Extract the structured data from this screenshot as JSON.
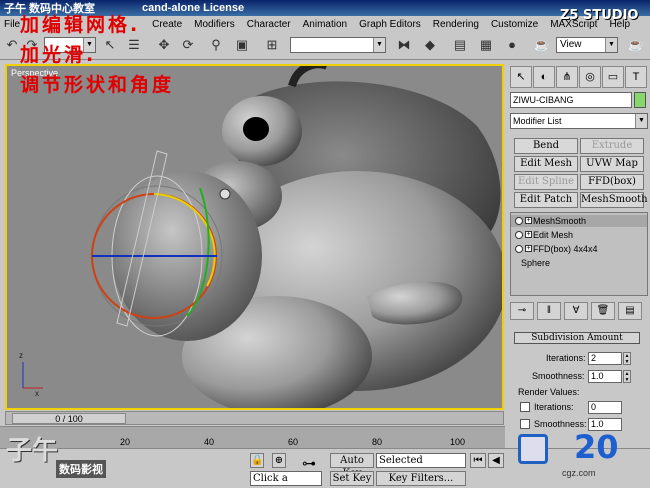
{
  "window": {
    "title": "cand-alone License",
    "watermark_corner": "子午 数码中心教室"
  },
  "menu": [
    "File",
    "Create",
    "Modifiers",
    "Character",
    "Animation",
    "Graph Editors",
    "Rendering",
    "Customize",
    "MAXScript",
    "Help"
  ],
  "toolbar": {
    "selection_combo": "",
    "view_combo": "View",
    "named_sets": ""
  },
  "studio_logo": "Z5 STUDIO",
  "overlay": {
    "line1": "加编辑网格.",
    "line2": "加光滑.",
    "line3": "调节形状和角度"
  },
  "viewport": {
    "label": "Perspective"
  },
  "command_panel": {
    "object_name": "ZIWU-CIBANG",
    "modifier_list": "Modifier List",
    "buttons": [
      {
        "label": "Bend",
        "enabled": true
      },
      {
        "label": "Extrude",
        "enabled": false
      },
      {
        "label": "Edit Mesh",
        "enabled": true
      },
      {
        "label": "UVW Map",
        "enabled": true
      },
      {
        "label": "Edit Spline",
        "enabled": false
      },
      {
        "label": "FFD(box)",
        "enabled": true
      },
      {
        "label": "Edit Patch",
        "enabled": true
      },
      {
        "label": "MeshSmooth",
        "enabled": true
      }
    ],
    "stack": [
      "MeshSmooth",
      "Edit Mesh",
      "FFD(box) 4x4x4",
      "Sphere"
    ],
    "rollout_title": "Subdivision Amount",
    "iterations_label": "Iterations:",
    "iterations_value": "2",
    "smoothness_label": "Smoothness:",
    "smoothness_value": "1.0",
    "render_values_label": "Render Values:",
    "r_iterations_label": "Iterations:",
    "r_iterations_value": "0",
    "r_smoothness_label": "Smoothness:",
    "r_smoothness_value": "1.0"
  },
  "timeline": {
    "frame_label": "0 / 100",
    "ticks": [
      "20",
      "40",
      "60",
      "80",
      "100"
    ]
  },
  "bottom": {
    "auto_key": "Auto Key",
    "set_key": "Set Key",
    "selected": "Selected",
    "key_filters": "Key Filters...",
    "status": "Click a",
    "frame_counter": "20"
  },
  "logos": {
    "left_brand": "子午",
    "left_sub": "数码影视",
    "right_site": "cgz.com"
  }
}
